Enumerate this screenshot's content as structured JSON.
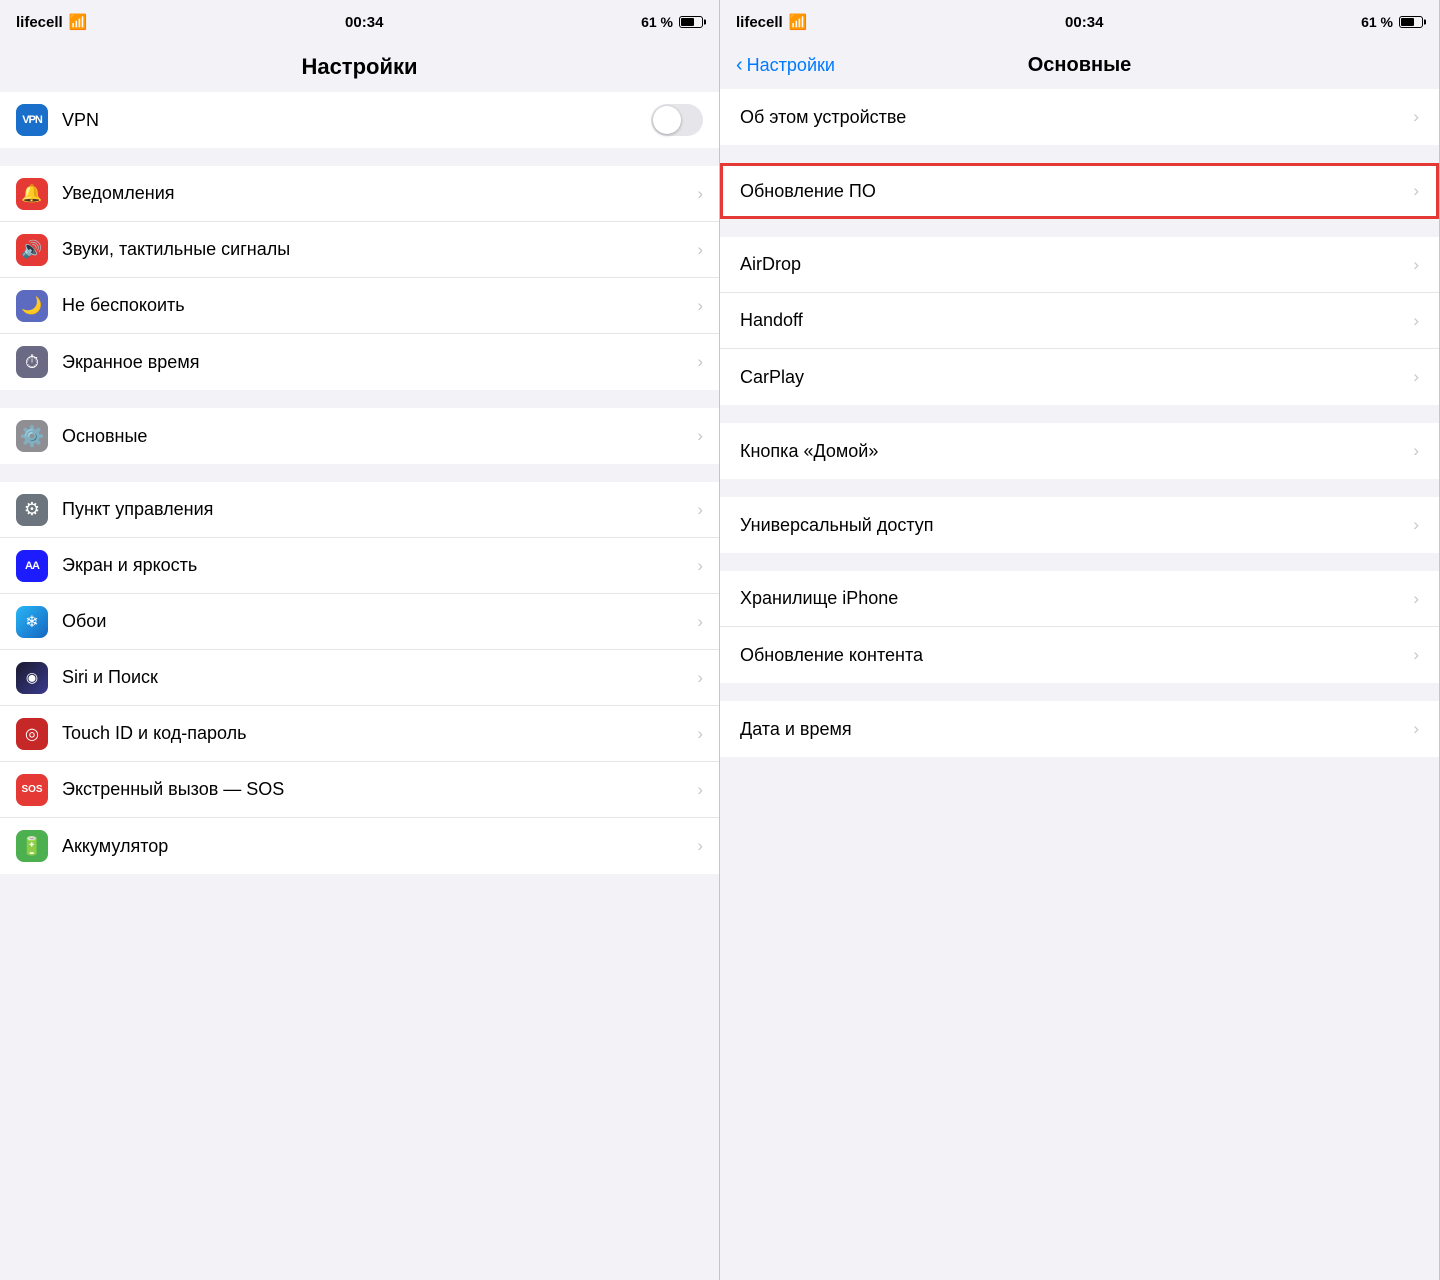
{
  "left": {
    "statusBar": {
      "carrier": "lifecell",
      "wifi": true,
      "time": "00:34",
      "battery_pct": "61 %"
    },
    "title": "Настройки",
    "vpn": {
      "label": "VPN",
      "toggle": "off"
    },
    "sections": [
      {
        "items": [
          {
            "id": "notifications",
            "label": "Уведомления",
            "icon": "notifications",
            "chevron": true
          },
          {
            "id": "sounds",
            "label": "Звуки, тактильные сигналы",
            "icon": "sounds",
            "chevron": true
          },
          {
            "id": "dnd",
            "label": "Не беспокоить",
            "icon": "dnd",
            "chevron": true
          },
          {
            "id": "screentime",
            "label": "Экранное время",
            "icon": "screentime",
            "chevron": true
          }
        ]
      },
      {
        "items": [
          {
            "id": "general",
            "label": "Основные",
            "icon": "general",
            "chevron": true,
            "highlighted": true
          }
        ]
      },
      {
        "items": [
          {
            "id": "control",
            "label": "Пункт управления",
            "icon": "control",
            "chevron": true
          },
          {
            "id": "display",
            "label": "Экран и яркость",
            "icon": "display",
            "chevron": true
          },
          {
            "id": "wallpaper",
            "label": "Обои",
            "icon": "wallpaper",
            "chevron": true
          },
          {
            "id": "siri",
            "label": "Siri и Поиск",
            "icon": "siri",
            "chevron": true
          },
          {
            "id": "touchid",
            "label": "Touch ID и код-пароль",
            "icon": "touchid",
            "chevron": true
          },
          {
            "id": "sos",
            "label": "Экстренный вызов — SOS",
            "icon": "sos",
            "chevron": true
          },
          {
            "id": "battery",
            "label": "Аккумулятор",
            "icon": "battery",
            "chevron": true
          }
        ]
      }
    ]
  },
  "right": {
    "statusBar": {
      "carrier": "lifecell",
      "wifi": true,
      "time": "00:34",
      "battery_pct": "61 %"
    },
    "backLabel": "Настройки",
    "title": "Основные",
    "sections": [
      {
        "items": [
          {
            "id": "about",
            "label": "Об этом устройстве",
            "chevron": true
          }
        ]
      },
      {
        "items": [
          {
            "id": "update",
            "label": "Обновление ПО",
            "chevron": true,
            "highlighted": true
          }
        ]
      },
      {
        "items": [
          {
            "id": "airdrop",
            "label": "AirDrop",
            "chevron": true
          },
          {
            "id": "handoff",
            "label": "Handoff",
            "chevron": true
          },
          {
            "id": "carplay",
            "label": "CarPlay",
            "chevron": true
          }
        ]
      },
      {
        "items": [
          {
            "id": "home",
            "label": "Кнопка «Домой»",
            "chevron": true
          }
        ]
      },
      {
        "items": [
          {
            "id": "accessibility",
            "label": "Универсальный доступ",
            "chevron": true
          }
        ]
      },
      {
        "items": [
          {
            "id": "storage",
            "label": "Хранилище iPhone",
            "chevron": true
          },
          {
            "id": "content-update",
            "label": "Обновление контента",
            "chevron": true
          }
        ]
      },
      {
        "items": [
          {
            "id": "datetime",
            "label": "Дата и время",
            "chevron": true
          }
        ]
      }
    ]
  },
  "icons": {
    "notifications": "🔔",
    "sounds": "🔊",
    "dnd": "🌙",
    "screentime": "⏱",
    "general": "⚙️",
    "control": "⚙",
    "display": "AA",
    "wallpaper": "❄",
    "siri": "◎",
    "touchid": "◎",
    "sos": "SOS",
    "battery": "🔋",
    "vpn": "VPN"
  }
}
